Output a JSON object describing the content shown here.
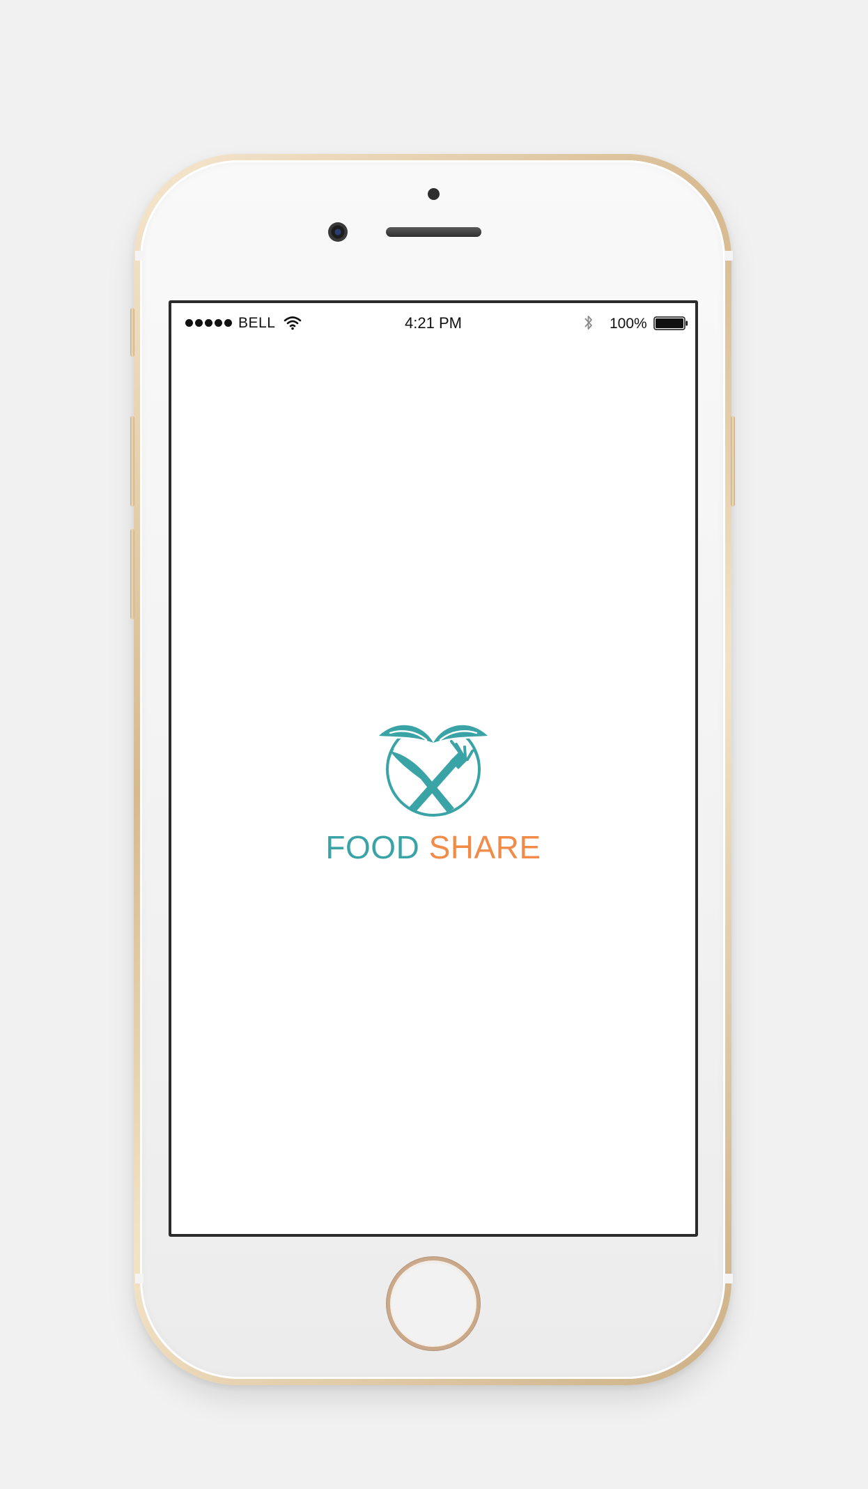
{
  "status_bar": {
    "carrier": "BELL",
    "time": "4:21 PM",
    "battery_percent": "100%",
    "signal_bars": 5,
    "battery_level": 1.0,
    "icons": [
      "signal-dots",
      "wifi-icon",
      "bluetooth-icon",
      "battery-icon"
    ]
  },
  "splash": {
    "logo_icon": "heart-leaves-knife-fork-icon",
    "brand_part_1": "FOOD",
    "brand_part_2": "SHARE"
  },
  "colors": {
    "brand_teal": "#3aa3a5",
    "brand_orange": "#f08c48",
    "phone_gold": "#d6b98f",
    "background": "#f1f1f1"
  }
}
